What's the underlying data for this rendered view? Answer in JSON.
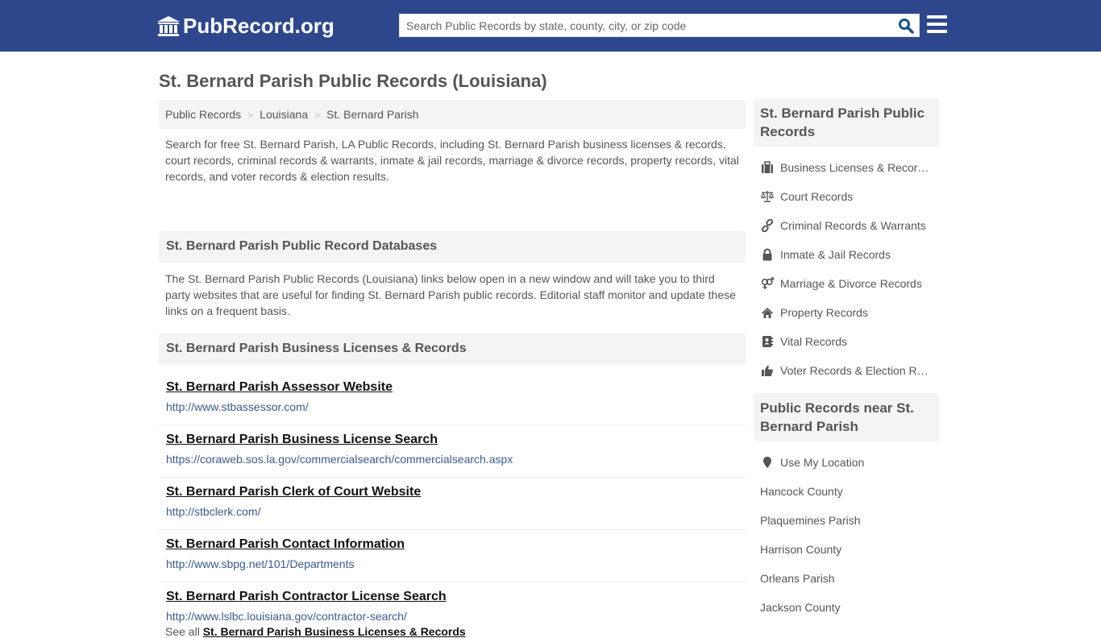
{
  "header": {
    "logo_text": "PubRecord.org",
    "search_placeholder": "Search Public Records by state, county, city, or zip code",
    "search_value": ""
  },
  "page_title": "St. Bernard Parish Public Records (Louisiana)",
  "breadcrumb": [
    "Public Records",
    "Louisiana",
    "St. Bernard Parish"
  ],
  "intro": "Search for free St. Bernard Parish, LA Public Records, including St. Bernard Parish business licenses & records, court records, criminal records & warrants, inmate & jail records, marriage & divorce records, property records, vital records, and voter records & election results.",
  "databases": {
    "heading": "St. Bernard Parish Public Record Databases",
    "description": "The St. Bernard Parish Public Records (Louisiana) links below open in a new window and will take you to third party websites that are useful for finding St. Bernard Parish public records. Editorial staff monitor and update these links on a frequent basis."
  },
  "business_section": {
    "heading": "St. Bernard Parish Business Licenses & Records",
    "links": [
      {
        "title": "St. Bernard Parish Assessor Website",
        "url": "http://www.stbassessor.com/"
      },
      {
        "title": "St. Bernard Parish Business License Search",
        "url": "https://coraweb.sos.la.gov/commercialsearch/commercialsearch.aspx"
      },
      {
        "title": "St. Bernard Parish Clerk of Court Website",
        "url": "http://stbclerk.com/"
      },
      {
        "title": "St. Bernard Parish Contact Information",
        "url": "http://www.sbpg.net/101/Departments"
      },
      {
        "title": "St. Bernard Parish Contractor License Search",
        "url": "http://www.lslbc.louisiana.gov/contractor-search/"
      }
    ],
    "see_all_prefix": "See all",
    "see_all_link": "St. Bernard Parish Business Licenses & Records"
  },
  "sidebar": {
    "records_heading": "St. Bernard Parish Public Records",
    "records": [
      {
        "label": "Business Licenses & Records",
        "icon": "briefcase-icon"
      },
      {
        "label": "Court Records",
        "icon": "balance-scale-icon"
      },
      {
        "label": "Criminal Records & Warrants",
        "icon": "link-icon"
      },
      {
        "label": "Inmate & Jail Records",
        "icon": "lock-icon"
      },
      {
        "label": "Marriage & Divorce Records",
        "icon": "venus-mars-icon"
      },
      {
        "label": "Property Records",
        "icon": "home-icon"
      },
      {
        "label": "Vital Records",
        "icon": "address-book-icon"
      },
      {
        "label": "Voter Records & Election Results",
        "icon": "thumbs-up-icon"
      }
    ],
    "near_heading": "Public Records near St. Bernard Parish",
    "use_location": "Use My Location",
    "nearby": [
      "Hancock County",
      "Plaquemines Parish",
      "Harrison County",
      "Orleans Parish",
      "Jackson County"
    ]
  },
  "colors": {
    "header_bg": "#2e478c",
    "section_bg": "#f4f4f4",
    "url_color": "#3a5a8c",
    "search_icon": "#1a4f8a"
  }
}
